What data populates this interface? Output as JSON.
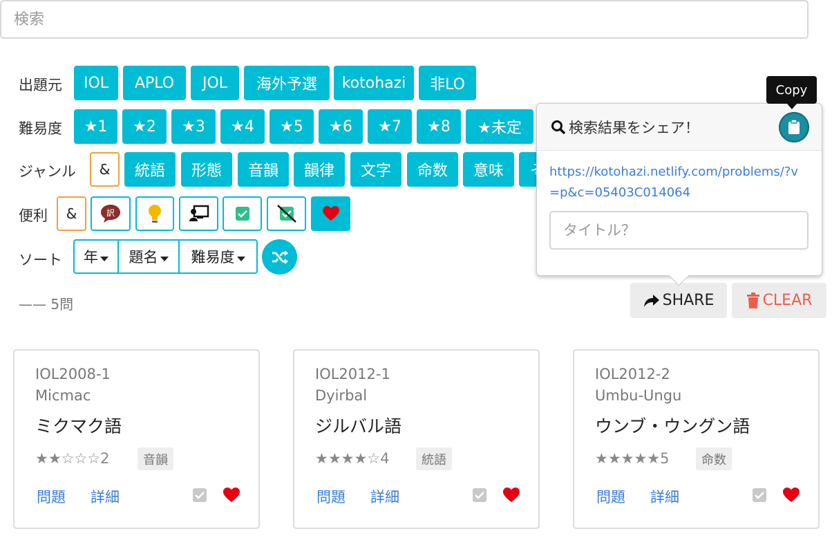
{
  "search": {
    "placeholder": "検索"
  },
  "filters": {
    "source": {
      "label": "出題元",
      "items": [
        "IOL",
        "APLO",
        "JOL",
        "海外予選",
        "kotohazi",
        "非LO"
      ]
    },
    "difficulty": {
      "label": "難易度",
      "items": [
        "★1",
        "★2",
        "★3",
        "★4",
        "★5",
        "★6",
        "★7",
        "★8",
        "★未定"
      ]
    },
    "genre": {
      "label": "ジャンル",
      "and_label": "&",
      "items": [
        "統語",
        "形態",
        "音韻",
        "韻律",
        "文字",
        "命数",
        "意味",
        "そ"
      ]
    },
    "utility": {
      "label": "便利",
      "and_label": "&",
      "icons": [
        "translation-icon",
        "lightbulb-icon",
        "presentation-icon",
        "checked-icon",
        "unchecked-icon",
        "heart-icon"
      ]
    }
  },
  "sort": {
    "label": "ソート",
    "options": [
      "年",
      "題名",
      "難易度"
    ]
  },
  "result_count": "—— 5問",
  "actions": {
    "share_label": "SHARE",
    "clear_label": "CLEAR",
    "accent": "#00bcd4",
    "clear_color": "#e8604c"
  },
  "share_popover": {
    "title": "検索結果をシェア！",
    "url": "https://kotohazi.netlify.com/problems/?v=p&c=05403C014064",
    "title_placeholder": "タイトル？",
    "tooltip": "Copy"
  },
  "problems": [
    {
      "id": "IOL2008-1",
      "language": "Micmac",
      "name": "ミクマク語",
      "stars": "★★☆☆☆2",
      "tag": "音韻",
      "problem_link": "問題",
      "detail_link": "詳細"
    },
    {
      "id": "IOL2012-1",
      "language": "Dyirbal",
      "name": "ジルバル語",
      "stars": "★★★★☆4",
      "tag": "統語",
      "problem_link": "問題",
      "detail_link": "詳細"
    },
    {
      "id": "IOL2012-2",
      "language": "Umbu-Ungu",
      "name": "ウンブ・ウングン語",
      "stars": "★★★★★5",
      "tag": "命数",
      "problem_link": "問題",
      "detail_link": "詳細"
    }
  ]
}
